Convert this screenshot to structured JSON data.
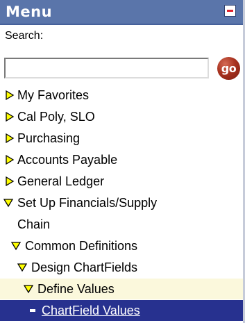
{
  "menu": {
    "title": "Menu",
    "minimize_label": "collapse menu"
  },
  "search": {
    "label": "Search:",
    "value": "",
    "placeholder": "",
    "go_label": "go"
  },
  "tree": {
    "items": [
      {
        "label": "My Favorites",
        "state": "collapsed"
      },
      {
        "label": "Cal Poly, SLO",
        "state": "collapsed"
      },
      {
        "label": "Purchasing",
        "state": "collapsed"
      },
      {
        "label": "Accounts Payable",
        "state": "collapsed"
      },
      {
        "label": "General Ledger",
        "state": "collapsed"
      },
      {
        "label_line1": "Set Up Financials/Supply",
        "label_line2": "Chain",
        "state": "expanded"
      },
      {
        "label": "Common Definitions",
        "state": "expanded"
      },
      {
        "label": "Design ChartFields",
        "state": "expanded"
      },
      {
        "label": "Define Values",
        "state": "expanded"
      },
      {
        "label": "ChartField Values",
        "state": "selected-leaf"
      }
    ]
  },
  "colors": {
    "header_bg": "#5a75aa",
    "selected_bg": "#27318f",
    "highlight_bg": "#fbf8dc",
    "arrow_fill": "#ffff00",
    "go_button": "#a8321f"
  }
}
